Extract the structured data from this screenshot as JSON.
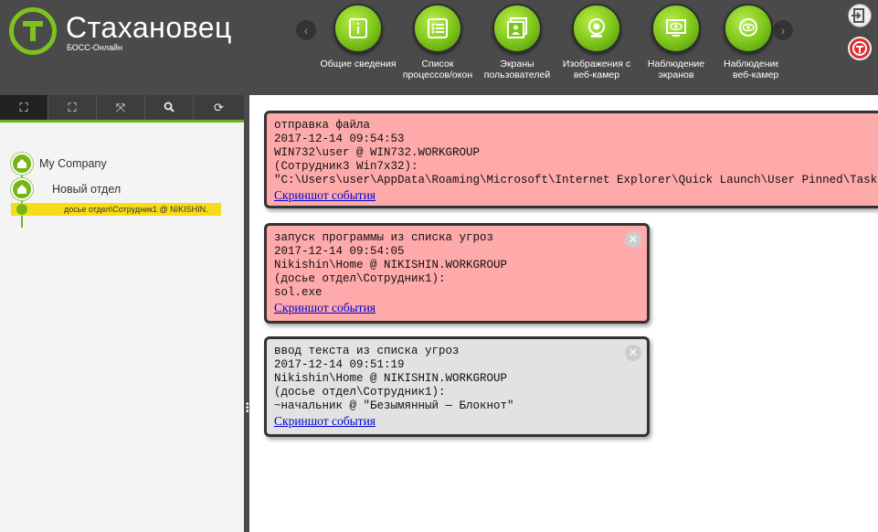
{
  "header": {
    "brand": "Стахановец",
    "brand_sub": "БОСС-Онлайн",
    "nav": [
      {
        "label1": "Общие сведения",
        "label2": "",
        "icon": "info-icon"
      },
      {
        "label1": "Список",
        "label2": "процессов/окон",
        "icon": "list-icon"
      },
      {
        "label1": "Экраны",
        "label2": "пользователей",
        "icon": "screens-icon"
      },
      {
        "label1": "Изображения с",
        "label2": "веб-камер",
        "icon": "webcam-icon"
      },
      {
        "label1": "Наблюдение",
        "label2": "экранов",
        "icon": "eye-screen-icon"
      },
      {
        "label1": "Наблюдение",
        "label2": "веб-камер",
        "icon": "eye-webcam-icon"
      }
    ]
  },
  "toolbar": {
    "buttons": [
      "expand-icon",
      "fit-icon",
      "collapse-icon",
      "search-icon",
      "refresh-icon"
    ]
  },
  "tree": {
    "root": "My Company",
    "dept": "Новый отдел",
    "selected": "досье отдел\\Сотрудник1 @ NIKISHIN."
  },
  "events": [
    {
      "type": "отправка файла",
      "time": "2017-12-14 09:54:53",
      "host": "WIN732\\user @ WIN732.WORKGROUP",
      "user": "(Сотрудник3 Win7x32):",
      "detail": "\"C:\\Users\\user\\AppData\\Roaming\\Microsoft\\Internet Explorer\\Quick Launch\\User Pinned\\TaskBar",
      "link": "Скриншот события",
      "color": "#ffaaaa"
    },
    {
      "type": "запуск программы из списка угроз",
      "time": "2017-12-14 09:54:05",
      "host": "Nikishin\\Home @ NIKISHIN.WORKGROUP",
      "user": "(досье отдел\\Сотрудник1):",
      "detail": "sol.exe",
      "link": "Скриншот события",
      "color": "#ffaaaa"
    },
    {
      "type": "ввод текста из списка угроз",
      "time": "2017-12-14 09:51:19",
      "host": "Nikishin\\Home @ NIKISHIN.WORKGROUP",
      "user": "(досье отдел\\Сотрудник1):",
      "detail": "~начальник @ \"Безымянный — Блокнот\"",
      "link": "Скриншот события",
      "color": "#e2e2e2"
    }
  ]
}
